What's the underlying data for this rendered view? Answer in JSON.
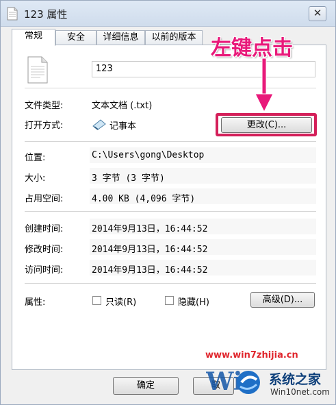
{
  "window": {
    "title": "123 属性",
    "close_glyph": "✕"
  },
  "tabs": [
    "常规",
    "安全",
    "详细信息",
    "以前的版本"
  ],
  "general": {
    "file_name": "123",
    "type_label": "文件类型:",
    "type_value": "文本文档 (.txt)",
    "opens_with_label": "打开方式:",
    "opens_with_value": "记事本",
    "change_button": "更改(C)...",
    "location_label": "位置:",
    "location_value": "C:\\Users\\gong\\Desktop",
    "size_label": "大小:",
    "size_value": "3 字节 (3 字节)",
    "disk_size_label": "占用空间:",
    "disk_size_value": "4.00 KB (4,096 字节)",
    "created_label": "创建时间:",
    "created_value": "2014年9月13日，16:44:52",
    "modified_label": "修改时间:",
    "modified_value": "2014年9月13日，16:44:52",
    "accessed_label": "访问时间:",
    "accessed_value": "2014年9月13日，16:44:52",
    "attributes_label": "属性:",
    "readonly_label": "只读(R)",
    "hidden_label": "隐藏(H)",
    "advanced_button": "高级(D)..."
  },
  "footer": {
    "ok_button": "确定",
    "cancel_partial": "取"
  },
  "annotation": {
    "text": "左键点击",
    "color": "#e8197a"
  },
  "watermark": {
    "url": "www.win7zhijia.cn",
    "brand": "系统之家",
    "site": "Win10net.com"
  }
}
